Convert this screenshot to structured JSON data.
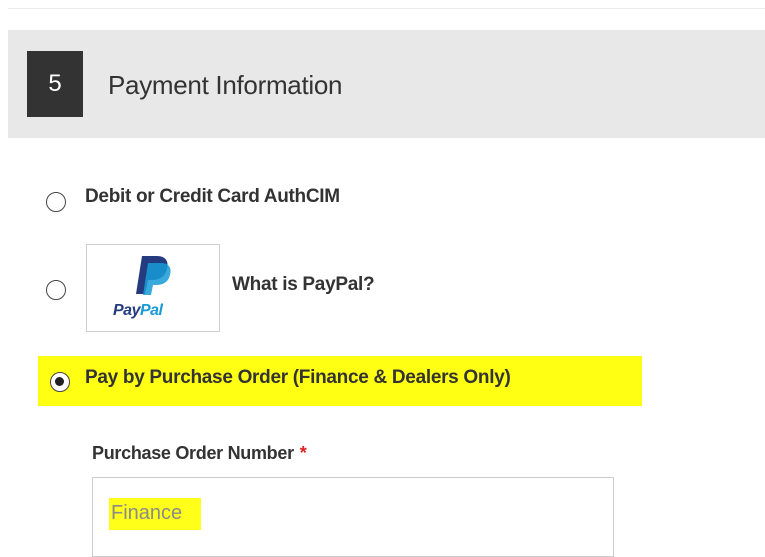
{
  "section": {
    "step_number": "5",
    "title": "Payment Information"
  },
  "payment_options": [
    {
      "label": "Debit or Credit Card AuthCIM",
      "selected": false
    },
    {
      "label": "What is PayPal?",
      "selected": false,
      "logo_text": {
        "part1": "Pay",
        "part2": "Pal"
      }
    },
    {
      "label": "Pay by Purchase Order (Finance & Dealers Only)",
      "selected": true,
      "highlighted": true
    }
  ],
  "purchase_order": {
    "label": "Purchase Order Number",
    "required_mark": "*",
    "value": "Finance"
  },
  "colors": {
    "header_bg": "#e8e8e8",
    "badge_bg": "#333333",
    "highlight": "#ffff00",
    "required": "#e02020",
    "paypal_dark": "#253b80",
    "paypal_light": "#179bd7"
  },
  "icons": {
    "paypal": "paypal-logo-icon",
    "radio": "radio-button-icon"
  }
}
